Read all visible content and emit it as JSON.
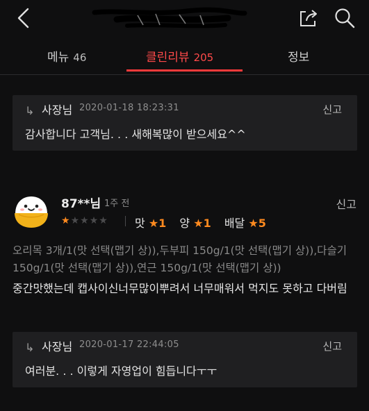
{
  "header": {
    "back_icon": "chevron-left-icon",
    "title_redacted": true,
    "share_icon": "share-icon",
    "search_icon": "search-icon"
  },
  "tabs": [
    {
      "label": "메뉴",
      "count": "46",
      "active": false
    },
    {
      "label": "클린리뷰",
      "count": "205",
      "active": true
    },
    {
      "label": "정보",
      "count": "",
      "active": false
    }
  ],
  "reply_top": {
    "arrow": "↳",
    "owner": "사장님",
    "date": "2020-01-18 18:23:31",
    "report": "신고",
    "text": "감사합니다 고객님. . . 새해복많이 받으세요^^"
  },
  "review": {
    "nickname": "87**님",
    "time": "1주 전",
    "report": "신고",
    "overall_stars": 1,
    "max_stars": 5,
    "ratings": [
      {
        "label": "맛",
        "value": "1"
      },
      {
        "label": "양",
        "value": "1"
      },
      {
        "label": "배달",
        "value": "5"
      }
    ],
    "menu": "오리목 3개/1(맛 선택(맵기 상)),두부피 150g/1(맛 선택(맵기 상)),다슬기 150g/1(맛 선택(맵기 상)),연근 150g/1(맛 선택(맵기 상))",
    "text": "중간맛했는데 캡사이신너무많이뿌려서 너무매워서 먹지도 못하고 다버림"
  },
  "reply_bottom": {
    "arrow": "↳",
    "owner": "사장님",
    "date": "2020-01-17 22:44:05",
    "report": "신고",
    "text": "여러분. . . 이렇게 자영업이 힘듭니다ㅜㅜ"
  },
  "colors": {
    "background": "#0f0f10",
    "accent": "#ff3b3b",
    "star": "#ff8a1f",
    "reply_bg": "#1f1f21"
  }
}
